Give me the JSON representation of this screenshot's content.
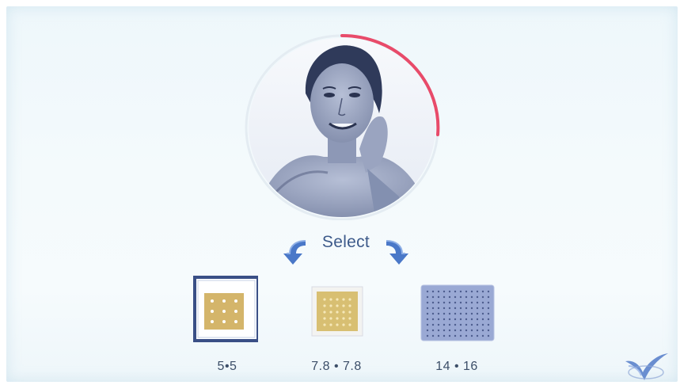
{
  "select": {
    "label": "Select"
  },
  "options": [
    {
      "label": "5•5",
      "selected": true
    },
    {
      "label": "7.8 • 7.8",
      "selected": false
    },
    {
      "label": "14 • 16",
      "selected": false
    }
  ],
  "colors": {
    "accent_ring": "#e84b6a",
    "pad_gold": "#d4b56a",
    "pad_blue": "#9aa9d4",
    "label_text": "#3d5a8a",
    "arrow_blue": "#4a78c8"
  },
  "icons": [
    "arrow-down-left-icon",
    "arrow-down-right-icon",
    "brand-logo-icon"
  ]
}
